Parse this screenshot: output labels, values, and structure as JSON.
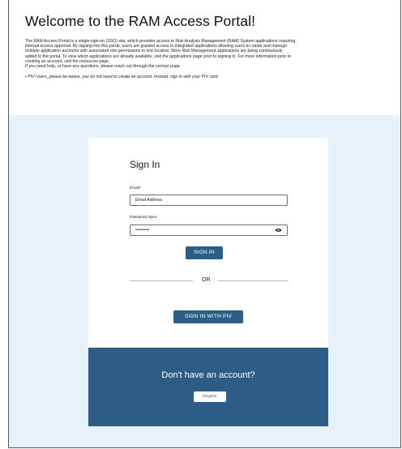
{
  "intro": {
    "title": "Welcome to the RAM Access Portal!",
    "paragraph_lines": [
      "The RAM Access Portal is a single-sign-on (SSO) site, which provides access to Risk Analysis Management (RAM) System applications requiring",
      "internal access approval. By signing into this portal, users are granted access to integrated applications allowing users to create and manage",
      "multiple application accounts with associated role permissions in one location. More Risk Management applications are being continuously",
      "added to the portal. To view which applications are already available, visit the applications page prior to signing in. For more information prior to",
      "creating an account, visit the resources page.",
      "If you need help, or have any questions, please reach out through the contact page."
    ],
    "piv_note": "• PIV Users, please be aware, you do not need to create an account. Instead, sign in with your PIV card."
  },
  "signin": {
    "heading": "Sign In",
    "email_label": "Email*",
    "email_value": "Email Address",
    "password_label": "Password Input",
    "password_value": "••••••••••",
    "password_toggle_icon": "eye-icon",
    "signin_button": "SIGN IN",
    "divider_text": "OR",
    "piv_button": "SIGN IN  WITH PIV"
  },
  "footer": {
    "question": "Don't have an account?",
    "register_button": "Register"
  },
  "colors": {
    "primary": "#2b5f87",
    "footer_bg": "#2d5d87",
    "band_bg": "#e8f2fb"
  }
}
